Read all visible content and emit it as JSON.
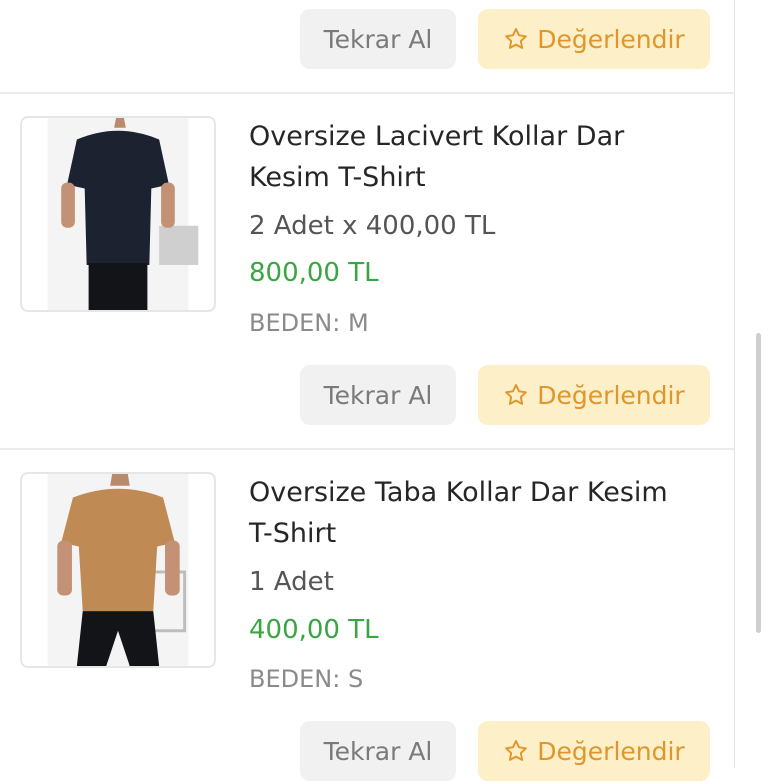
{
  "actions": {
    "reorder_label": "Tekrar Al",
    "rate_label": "Değerlendir",
    "rate_icon": "star-outline-icon",
    "rate_color": "#e0962a",
    "rate_bg": "#fdefc7"
  },
  "items": [
    {
      "title_line1": "Oversize Lacivert Kollar Dar",
      "title_line2": "Kesim T-Shirt",
      "quantity": "2 Adet  x  400,00 TL",
      "total": "800,00 TL",
      "size": "BEDEN: M",
      "shirt_color": "#1d2230"
    },
    {
      "title_line1": "Oversize Taba Kollar Dar Kesim",
      "title_line2": "T-Shirt",
      "quantity": "1 Adet",
      "total": "400,00 TL",
      "size": "BEDEN: S",
      "shirt_color": "#c08a55"
    }
  ]
}
